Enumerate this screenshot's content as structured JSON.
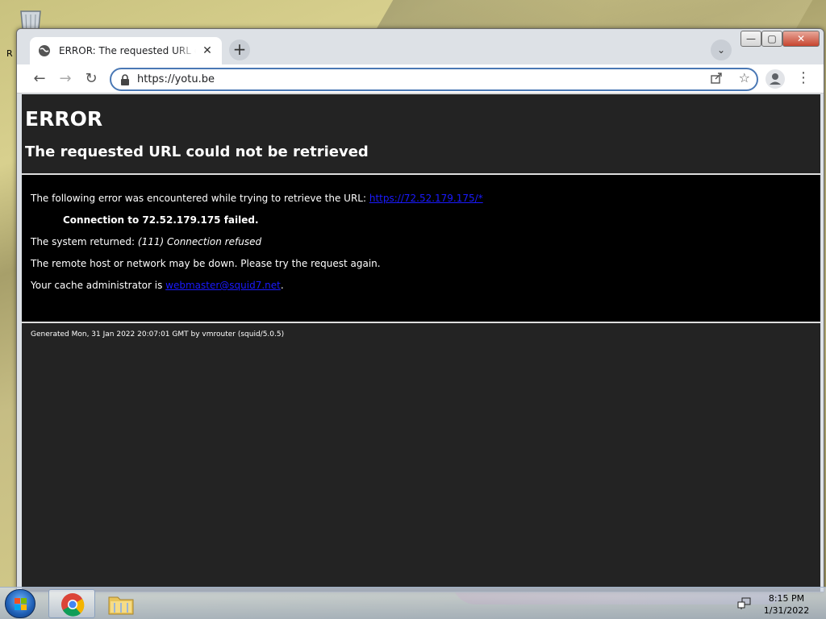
{
  "desktop": {
    "recycle_label": "R"
  },
  "browser": {
    "tab_title": "ERROR: The requested URL could not be retrieved",
    "tab_close": "✕",
    "new_tab": "+",
    "tab_search": "⌄",
    "window_controls": {
      "minimize": "—",
      "maximize": "▢",
      "close": "✕"
    },
    "nav": {
      "back": "←",
      "forward": "→",
      "reload": "↻"
    },
    "url": "https://yotu.be",
    "menu": "⋮"
  },
  "page": {
    "h1": "ERROR",
    "h2": "The requested URL could not be retrieved",
    "line1_text": "The following error was encountered while trying to retrieve the URL: ",
    "line1_link": "https://72.52.179.175/*",
    "line2": "Connection to 72.52.179.175 failed.",
    "line3_text": "The system returned: ",
    "line3_em": "(111) Connection refused",
    "line4": "The remote host or network may be down. Please try the request again.",
    "line5_text": "Your cache administrator is ",
    "line5_link": "webmaster@squid7.net",
    "line5_end": ".",
    "footer": "Generated Mon, 31 Jan 2022 20:07:01 GMT by vmrouter (squid/5.0.5)"
  },
  "taskbar": {
    "time": "8:15 PM",
    "date": "1/31/2022"
  },
  "colors": {
    "page_bg": "#232323",
    "error_box_bg": "#000000",
    "link": "#1a1aff",
    "omnibox_border": "#4a78b5"
  }
}
